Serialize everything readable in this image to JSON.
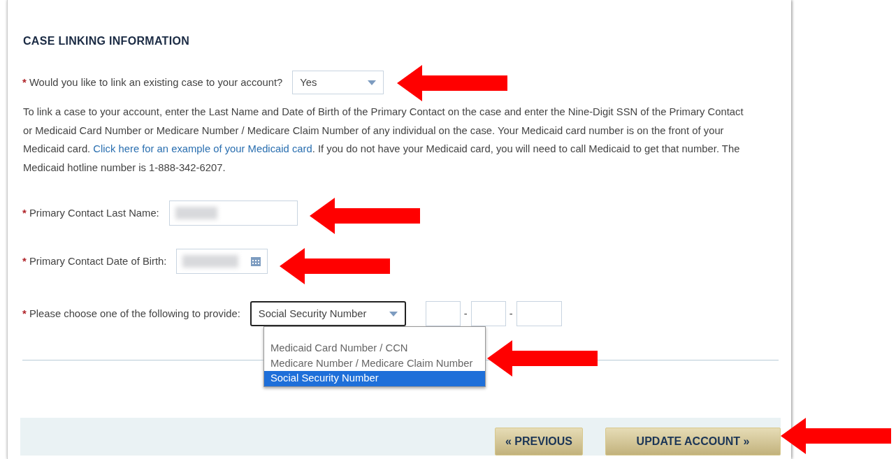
{
  "section_title": "CASE LINKING INFORMATION",
  "link_question": {
    "label": "Would you like to link an existing case to your account?",
    "marker": "*",
    "value": "Yes"
  },
  "instructions": {
    "before_link": "To link a case to your account, enter the Last Name and Date of Birth of the Primary Contact on the case and enter the Nine-Digit SSN of the Primary Contact or Medicaid Card Number or Medicare Number / Medicare Claim Number of any individual on the case. Your Medicaid card number is on the front of your Medicaid card. ",
    "link": "Click here for an example of your Medicaid card",
    "after_link": ". If you do not have your Medicaid card, you will need to call Medicaid to get that number. The Medicaid hotline number is 1-888-342-6207."
  },
  "fields": [
    {
      "kind": "text",
      "label": "Primary Contact Last Name:",
      "marker": "*",
      "redacted": true
    },
    {
      "kind": "date",
      "label": "Primary Contact Date of Birth:",
      "marker": "*",
      "redacted": true
    }
  ],
  "id_choice": {
    "label": "Please choose one of the following to provide:",
    "marker": "*",
    "value": "Social Security Number",
    "expanded": true,
    "options": [
      {
        "label": "Medicaid Card Number / CCN",
        "selected": false
      },
      {
        "label": "Medicare Number / Medicare Claim Number",
        "selected": false
      },
      {
        "label": "Social Security Number",
        "selected": true
      }
    ],
    "ssn_separators": [
      "-",
      "-"
    ]
  },
  "buttons": [
    {
      "kind": "previous",
      "label": "« PREVIOUS"
    },
    {
      "kind": "submit",
      "label": "UPDATE ACCOUNT »"
    }
  ],
  "annotations": [
    {
      "kind": "arrow"
    },
    {
      "kind": "arrow"
    },
    {
      "kind": "arrow"
    },
    {
      "kind": "arrow"
    },
    {
      "kind": "arrow"
    }
  ]
}
